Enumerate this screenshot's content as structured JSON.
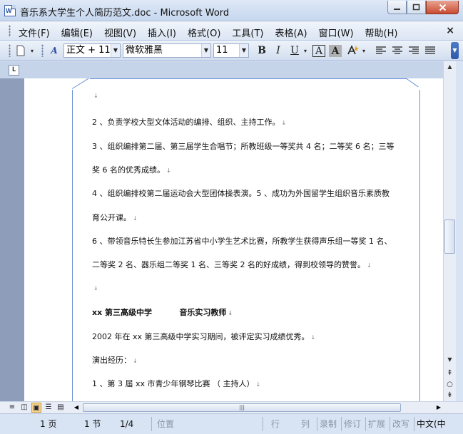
{
  "window": {
    "title": "音乐系大学生个人简历范文.doc - Microsoft Word",
    "icon_name": "word-document-icon"
  },
  "menu": {
    "items": [
      "文件(F)",
      "编辑(E)",
      "视图(V)",
      "插入(I)",
      "格式(O)",
      "工具(T)",
      "表格(A)",
      "窗口(W)",
      "帮助(H)"
    ],
    "close_label": "×"
  },
  "toolbar": {
    "style_value": "正文 + 11",
    "font_value": "微软雅黑",
    "size_value": "11",
    "bold_label": "B",
    "italic_label": "I",
    "underline_label": "U",
    "charborder_label": "A",
    "charshade_label": "A"
  },
  "ruler": {
    "tab_selector": "L"
  },
  "document": {
    "lines": [
      "2 、负责学校大型文体活动的编排、组织、主持工作。",
      "3 、组织编排第二届、第三届学生合唱节；所教班级一等奖共 4 名；二等奖 6 名；三等",
      "奖 6 名的优秀成绩。",
      "4 、组织编排校第二届运动会大型团体操表演。5 、成功为外国留学生组织音乐素质教",
      "育公开课。",
      "6 、带领音乐特长生参加江苏省中小学生艺术比赛，所教学生获得声乐组一等奖 1 名、",
      "二等奖 2 名、器乐组二等奖 1 名、三等奖 2 名的好成绩，得到校领导的赞誉。",
      "",
      "xx 第三高级中学          音乐实习教师",
      "2002 年在 xx 第三高级中学实习期间，被评定实习成绩优秀。",
      "演出经历：",
      "1 、第 3 届 xx 市青少年钢琴比赛 （ 主持人）"
    ]
  },
  "statusbar": {
    "page": "1 页",
    "section": "1 节",
    "page_of": "1/4",
    "position": "位置",
    "line": "行",
    "column": "列",
    "rec": "录制",
    "trk": "修订",
    "ext": "扩展",
    "ovr": "改写",
    "language": "中文(中"
  }
}
